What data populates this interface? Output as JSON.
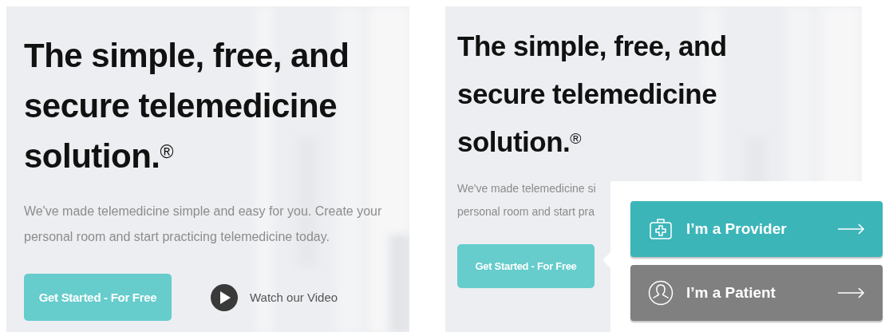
{
  "panels": [
    {
      "heading_lines": [
        "The simple, free, and",
        "secure telemedicine",
        "solution.$^{®}$"
      ],
      "description_lines": [
        "We've made telemedicine simple and easy for you. Create your",
        "personal room and start practicing telemedicine today."
      ],
      "cta": "Get Started - For Free",
      "video_link": "Watch our Video"
    },
    {
      "heading_lines": [
        "The simple, free, and",
        "secure telemedicine",
        "solution.$^{®}$"
      ],
      "description_lines": [
        "We've made telemedicine si",
        "personal room and start pra"
      ],
      "cta": "Get Started - For Free",
      "popover": [
        {
          "kind": "provider",
          "label": "I’m a Provider"
        },
        {
          "kind": "patient",
          "label": "I’m a Patient"
        }
      ]
    }
  ]
}
